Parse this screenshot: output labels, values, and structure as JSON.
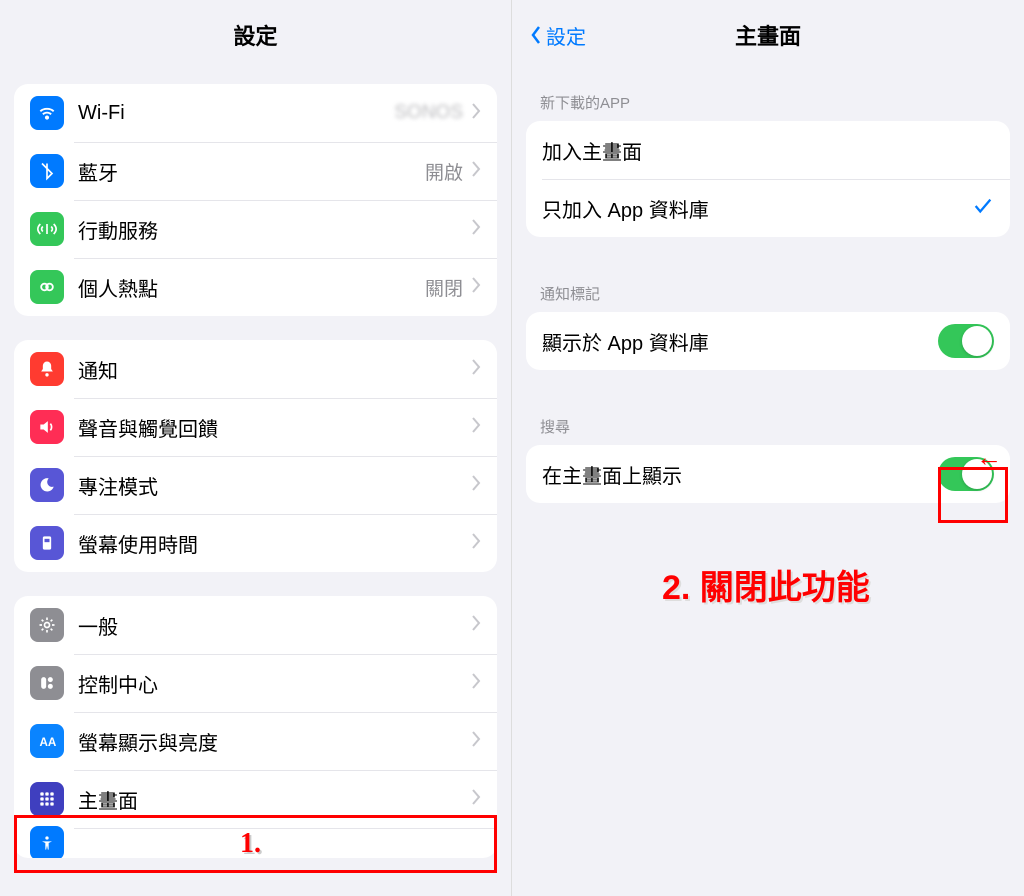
{
  "left": {
    "title": "設定",
    "groups": [
      {
        "rows": [
          {
            "icon": "wifi",
            "label": "Wi-Fi",
            "value": "SONOS"
          },
          {
            "icon": "bluetooth",
            "label": "藍牙",
            "value": "開啟"
          },
          {
            "icon": "cellular",
            "label": "行動服務",
            "value": ""
          },
          {
            "icon": "hotspot",
            "label": "個人熱點",
            "value": "關閉"
          }
        ]
      },
      {
        "rows": [
          {
            "icon": "notifications",
            "label": "通知"
          },
          {
            "icon": "sounds",
            "label": "聲音與觸覺回饋"
          },
          {
            "icon": "focus",
            "label": "專注模式"
          },
          {
            "icon": "screentime",
            "label": "螢幕使用時間"
          }
        ]
      },
      {
        "rows": [
          {
            "icon": "general",
            "label": "一般"
          },
          {
            "icon": "controlcenter",
            "label": "控制中心"
          },
          {
            "icon": "display",
            "label": "螢幕顯示與亮度"
          },
          {
            "icon": "homescreen",
            "label": "主畫面"
          },
          {
            "icon": "accessibility",
            "label": ""
          }
        ]
      }
    ]
  },
  "right": {
    "back_label": "設定",
    "title": "主畫面",
    "sections": [
      {
        "header": "新下載的APP",
        "rows": [
          {
            "label": "加入主畫面",
            "checked": false
          },
          {
            "label": "只加入 App 資料庫",
            "checked": true
          }
        ]
      },
      {
        "header": "通知標記",
        "rows": [
          {
            "label": "顯示於 App 資料庫",
            "toggle": true
          }
        ]
      },
      {
        "header": "搜尋",
        "rows": [
          {
            "label": "在主畫面上顯示",
            "toggle": true
          }
        ]
      }
    ]
  },
  "annotations": {
    "step1": "1.",
    "step2": "2. 關閉此功能"
  }
}
